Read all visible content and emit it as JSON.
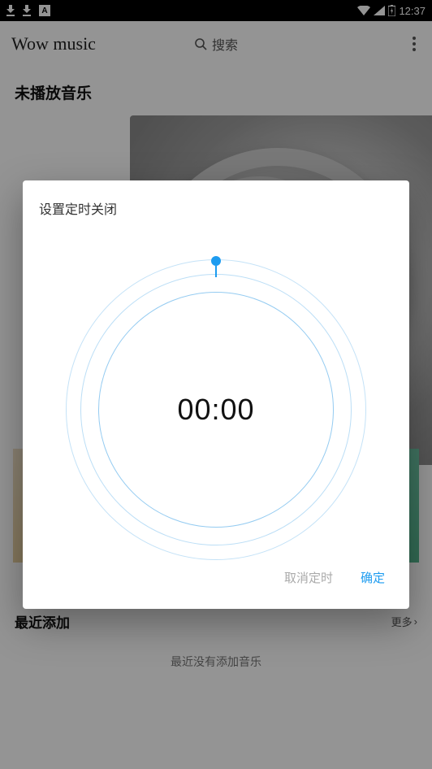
{
  "status": {
    "square_icon_letter": "A",
    "time": "12:37"
  },
  "app": {
    "title": "Wow music",
    "search_label": "搜索"
  },
  "main": {
    "now_playing_title": "未播放音乐",
    "recent_title": "最近添加",
    "more_label": "更多",
    "more_arrow": "›",
    "empty_message": "最近没有添加音乐"
  },
  "dialog": {
    "title": "设置定时关闭",
    "time_value": "00:00",
    "cancel_label": "取消定时",
    "confirm_label": "确定"
  }
}
